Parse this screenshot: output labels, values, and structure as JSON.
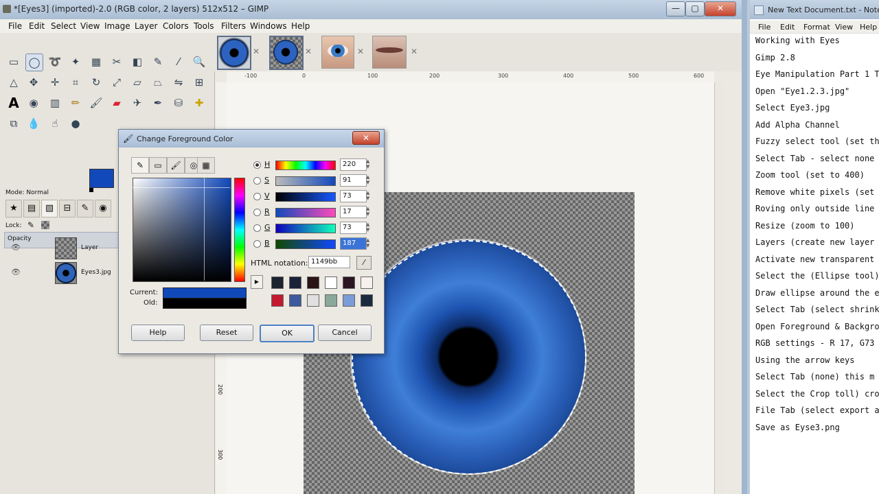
{
  "gimp": {
    "title": "*[Eyes3] (imported)-2.0 (RGB color, 2 layers) 512x512 – GIMP",
    "window_controls": {
      "minimize": "—",
      "maximize": "▢",
      "close": "✕"
    },
    "menu": [
      "File",
      "Edit",
      "Select",
      "View",
      "Image",
      "Layer",
      "Colors",
      "Tools",
      "Filters",
      "Windows",
      "Help"
    ],
    "tool_options": {
      "mode_label": "Mode: Normal",
      "opacity_label": "Opacity",
      "lock_label": "Lock:"
    },
    "fg_color": "#1149bb",
    "layers": [
      {
        "name": "Layer"
      },
      {
        "name": "Eyes3.jpg"
      }
    ],
    "ruler_ticks": [
      "-100",
      "0",
      "100",
      "200",
      "300",
      "400",
      "500",
      "600"
    ],
    "v_ruler_ticks": [
      "0",
      "100",
      "200",
      "300"
    ]
  },
  "dialog": {
    "title": "Change Foreground Color",
    "channels": [
      {
        "label": "H",
        "value": "220",
        "active": true
      },
      {
        "label": "S",
        "value": "91",
        "active": false
      },
      {
        "label": "V",
        "value": "73",
        "active": false
      },
      {
        "label": "R",
        "value": "17",
        "active": false
      },
      {
        "label": "G",
        "value": "73",
        "active": false
      },
      {
        "label": "B",
        "value": "187",
        "active": false
      }
    ],
    "html_notation_label": "HTML notation:",
    "html_value": "1149bb",
    "history_swatches_row1": [
      "#1c2430",
      "#1a2238",
      "#2a1418",
      "#ffffff",
      "#2a1520",
      "#f6f0ee"
    ],
    "history_swatches_row2": [
      "#c41a30",
      "#3c5a9c",
      "#e0e0e0",
      "#8aa89a",
      "#7a9cd8",
      "#1c2a3e"
    ],
    "current_label": "Current:",
    "old_label": "Old:",
    "current_color": "#1149bb",
    "old_color": "#000000",
    "buttons": {
      "help": "Help",
      "reset": "Reset",
      "ok": "OK",
      "cancel": "Cancel"
    }
  },
  "notepad": {
    "title": "New Text Document.txt - Notepad",
    "menu": [
      "File",
      "Edit",
      "Format",
      "View",
      "Help"
    ],
    "lines": [
      "Working with Eyes",
      "Gimp 2.8",
      "Eye Manipulation Part 1 T",
      "Open \"Eye1.2.3.jpg\"",
      "Select Eye3.jpg",
      "Add Alpha Channel",
      "Fuzzy select tool (set th",
      "Select Tab - select none",
      "Zoom tool (set to 400)",
      "Remove white pixels (set",
      "Roving only outside line",
      "Resize (zoom to 100)",
      "Layers (create new layer",
      "Activate new transparent",
      "Select the (Ellipse tool)",
      "Draw ellipse around the e",
      "Select Tab (select shrink",
      "Open Foreground & Backgro",
      "RGB settings - R 17, G73",
      "Using the arrow keys",
      " Select Tab (none) this m",
      "Select the Crop toll) cro",
      "File Tab (select export a",
      "Save as Eyse3.png"
    ]
  }
}
